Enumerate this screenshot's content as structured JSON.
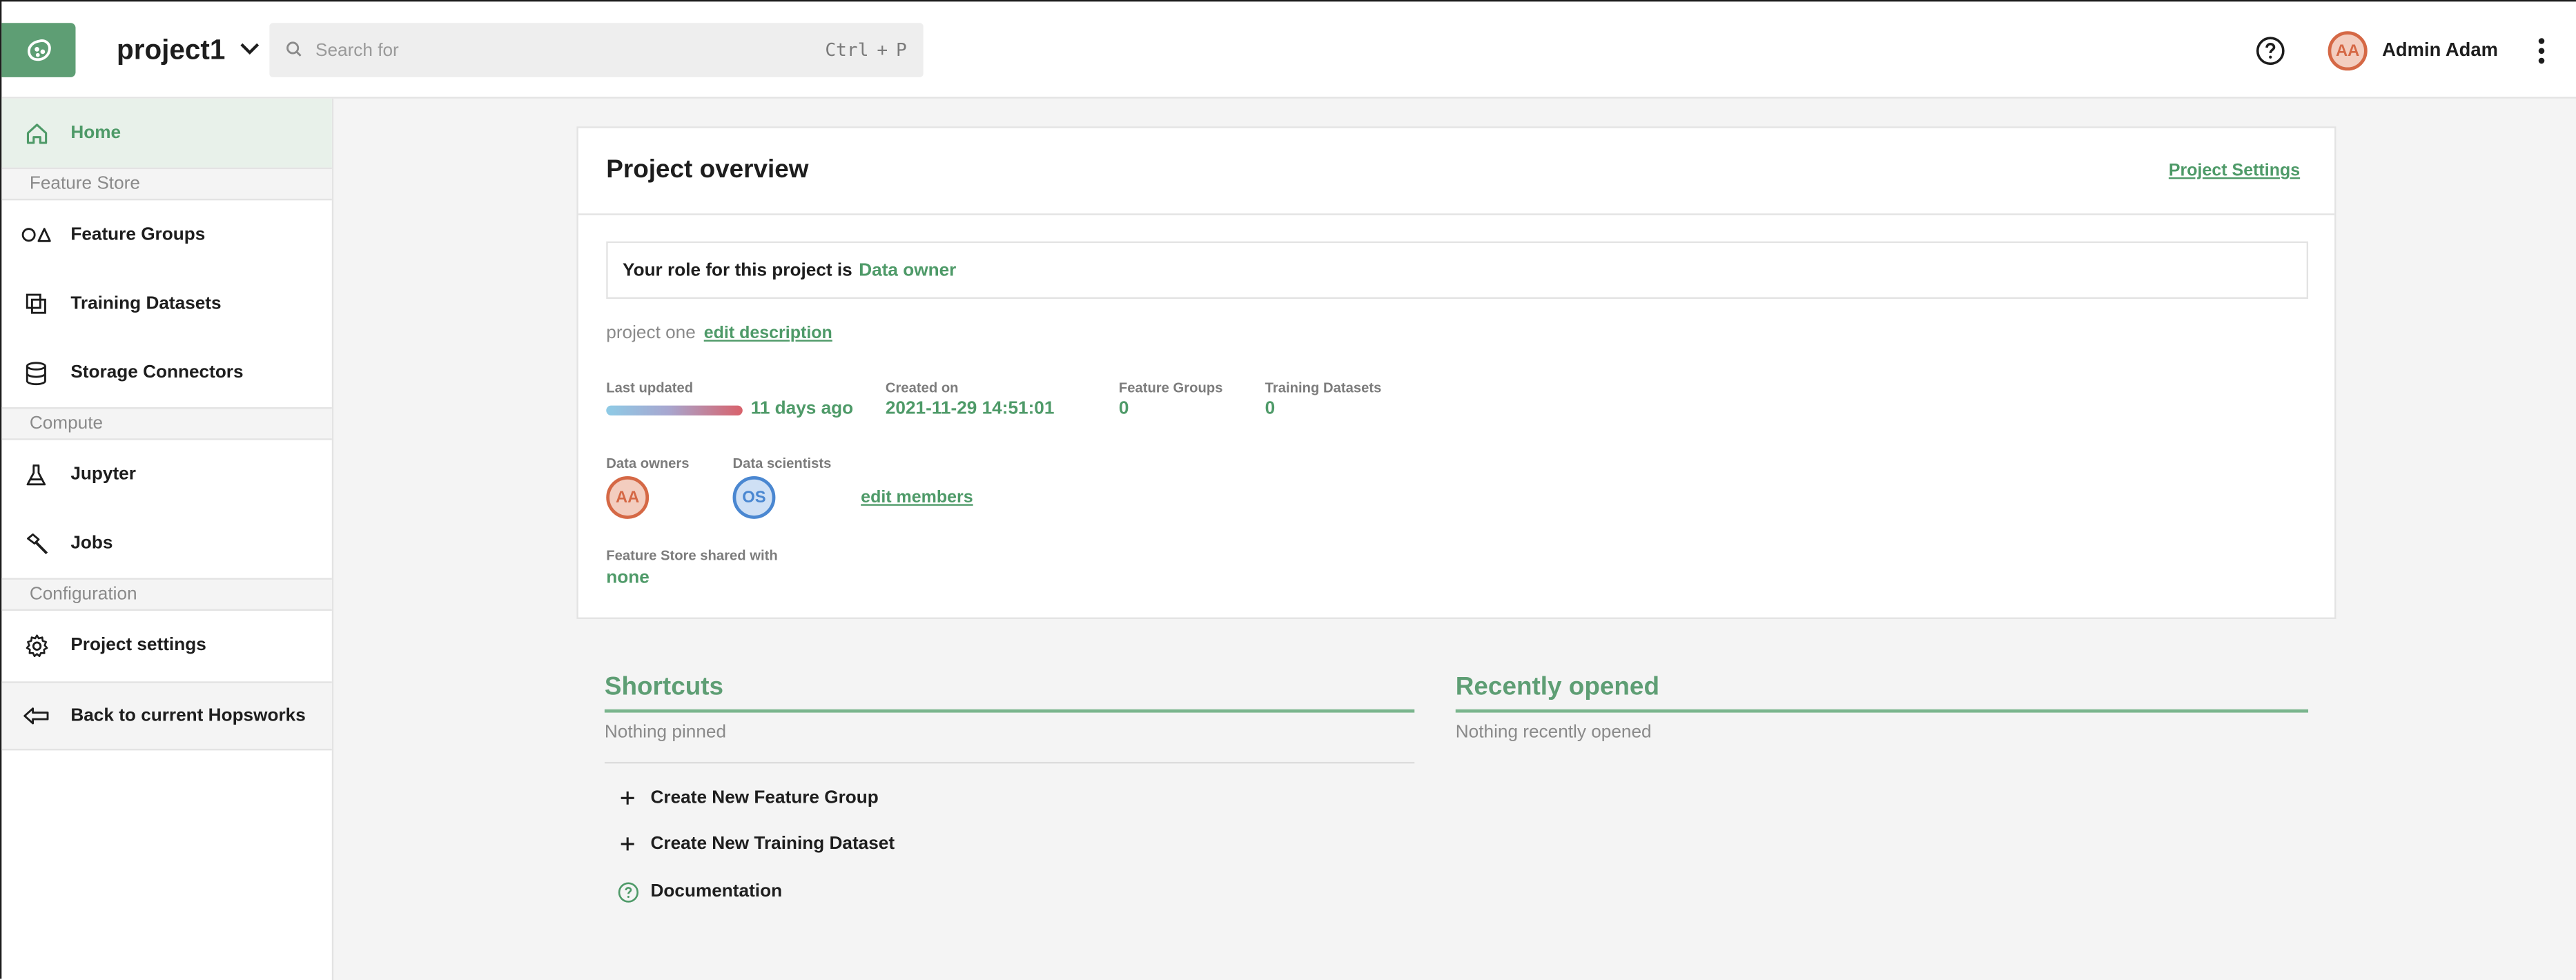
{
  "header": {
    "project_name": "project1",
    "search_placeholder": "Search for",
    "shortcut_key1": "Ctrl",
    "shortcut_plus": "+",
    "shortcut_key2": "P",
    "user_initials": "AA",
    "user_name": "Admin Adam",
    "icons": [
      "hopsworks-logo-icon",
      "chevron-down-icon",
      "search-icon",
      "help-icon",
      "more-vertical-icon"
    ]
  },
  "sidebar": {
    "home": "Home",
    "sections": {
      "feature_store": "Feature Store",
      "compute": "Compute",
      "configuration": "Configuration"
    },
    "items": {
      "feature_groups": "Feature Groups",
      "training_datasets": "Training Datasets",
      "storage_connectors": "Storage Connectors",
      "jupyter": "Jupyter",
      "jobs": "Jobs",
      "project_settings": "Project settings",
      "back": "Back to current Hopsworks"
    }
  },
  "overview": {
    "title": "Project overview",
    "settings_link": "Project Settings",
    "role_label": "Your role for this project is",
    "role_value": "Data owner",
    "description": "project one",
    "edit_description": "edit description",
    "last_updated_label": "Last updated",
    "last_updated_value": "11 days ago",
    "created_label": "Created on",
    "created_value": "2021-11-29 14:51:01",
    "feature_groups_label": "Feature Groups",
    "feature_groups_value": "0",
    "training_datasets_label": "Training Datasets",
    "training_datasets_value": "0",
    "data_owners_label": "Data owners",
    "data_owner_initials": "AA",
    "data_scientists_label": "Data scientists",
    "data_scientist_initials": "OS",
    "edit_members": "edit members",
    "shared_label": "Feature Store shared with",
    "shared_value": "none"
  },
  "shortcuts": {
    "title": "Shortcuts",
    "empty": "Nothing pinned",
    "items": [
      "Create New Feature Group",
      "Create New Training Dataset",
      "Documentation"
    ]
  },
  "recent": {
    "title": "Recently opened",
    "empty": "Nothing recently opened"
  },
  "colors": {
    "accent": "#4e9a68",
    "logo_bg": "#5e9e74",
    "owner_avatar": "#d56845",
    "scientist_avatar": "#4a87d1"
  }
}
